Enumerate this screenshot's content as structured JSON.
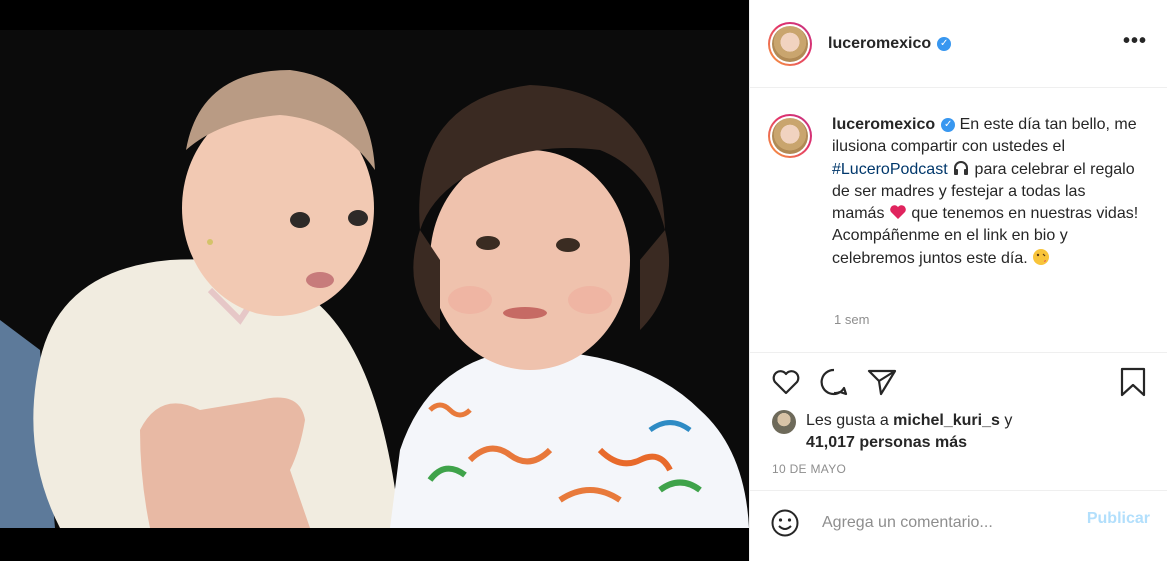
{
  "post": {
    "username": "luceromexico",
    "more_label": "•••",
    "caption_prefix": " En este día tan bello, me ilusiona compartir con ustedes el ",
    "hashtag": "#LuceroPodcast",
    "caption_mid1": " para celebrar el regalo de ser madres y festejar a todas las mamás ",
    "caption_mid2": " que tenemos en nuestras vidas! Acompáñenme en el link en bio y celebremos juntos este día. ",
    "caption_time": "1 sem",
    "likes_prefix": "Les gusta a ",
    "liker": "michel_kuri_s",
    "likes_mid": " y",
    "likes_count": "41,017 personas más",
    "date": "10 DE MAYO",
    "comment_placeholder": "Agrega un comentario...",
    "publish_label": "Publicar"
  },
  "icons": [
    "verified-badge-icon",
    "headphones-icon",
    "heart-emoji-icon",
    "kiss-emoji-icon",
    "heart-icon",
    "comment-icon",
    "share-icon",
    "bookmark-icon",
    "smiley-icon"
  ],
  "colors": {
    "link": "#00376b",
    "verified": "#3897f0",
    "publish": "#b2dffc",
    "muted": "#8e8e8e"
  }
}
